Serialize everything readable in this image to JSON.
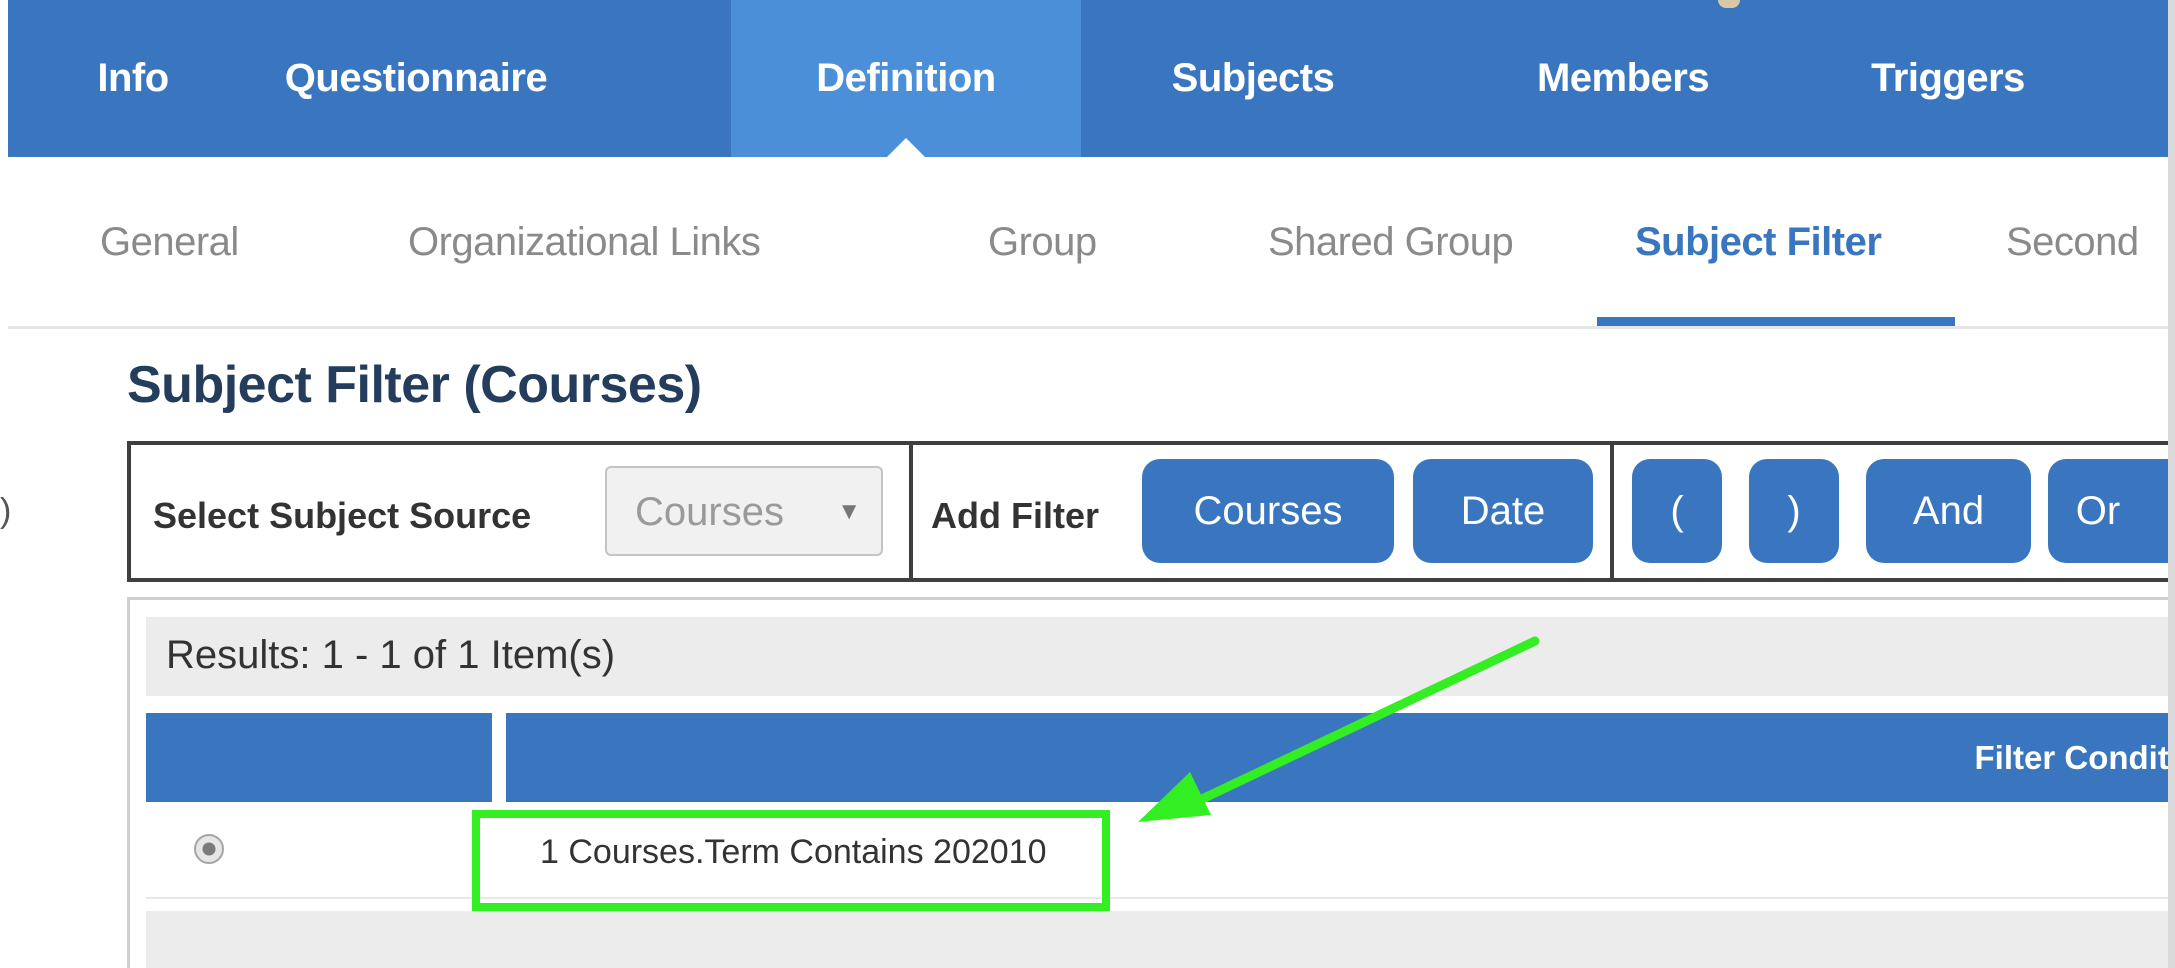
{
  "top_nav": {
    "tabs": [
      {
        "label": "Info"
      },
      {
        "label": "Questionnaire"
      },
      {
        "label": "Definition",
        "active": true
      },
      {
        "label": "Subjects"
      },
      {
        "label": "Members"
      },
      {
        "label": "Triggers"
      }
    ]
  },
  "sub_nav": {
    "tabs": [
      {
        "label": "General"
      },
      {
        "label": "Organizational Links"
      },
      {
        "label": "Group"
      },
      {
        "label": "Shared Group"
      },
      {
        "label": "Subject Filter",
        "active": true
      },
      {
        "label": "Second"
      }
    ]
  },
  "page": {
    "title": "Subject Filter (Courses)",
    "edge_glyph": ")"
  },
  "toolbar": {
    "source_label": "Select Subject Source",
    "source_value": "Courses",
    "source_arrow": "▼",
    "add_filter_label": "Add Filter",
    "filter_buttons": [
      "Courses",
      "Date"
    ],
    "operator_buttons": [
      "(",
      ")",
      "And",
      "Or"
    ]
  },
  "results": {
    "summary": "Results: 1 - 1 of 1 Item(s)",
    "column_condition": "Filter Conditi",
    "rows": [
      {
        "condition": "1 Courses.Term Contains 202010",
        "selected": true
      }
    ]
  },
  "colors": {
    "nav_blue": "#3a76bf",
    "nav_active": "#4a8fd8",
    "title": "#243d5c",
    "annotation_green": "#33ee22"
  },
  "icons": {
    "select_arrow": "caret-down-icon",
    "radio": "radio-selected-icon",
    "annotation": "arrow-icon"
  }
}
